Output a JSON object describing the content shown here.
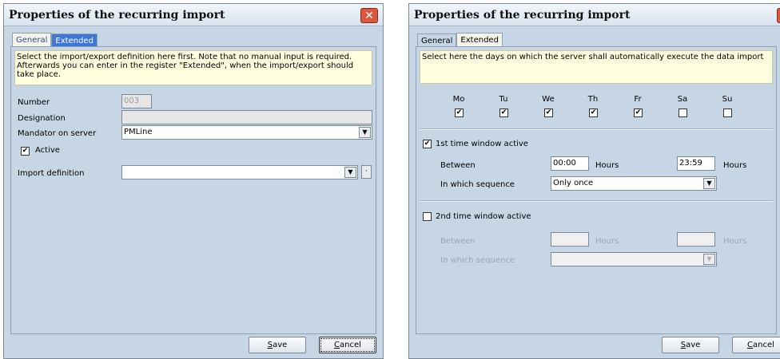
{
  "left_dialog": {
    "title": "Properties of the recurring import",
    "close_glyph": "✕",
    "tabs": [
      "General",
      "Extended"
    ],
    "info": "Select the import/export definition here first. Note that no manual input is required. Afterwards you can enter in the register \"Extended\", when the import/export should take place.",
    "number_label": "Number",
    "number_value": "003",
    "designation_label": "Designation",
    "designation_value": "",
    "mandator_label": "Mandator on server",
    "mandator_value": "PMLine",
    "active_label": "Active",
    "active_checked": true,
    "import_def_label": "Import definition",
    "import_def_value": "",
    "save_label": "Save",
    "cancel_label": "Cancel"
  },
  "right_dialog": {
    "title": "Properties of the recurring import",
    "close_glyph": "✕",
    "tabs": [
      "General",
      "Extended"
    ],
    "info": "Select here the days on which the server shall automatically execute the data import",
    "days": [
      {
        "label": "Mo",
        "checked": true
      },
      {
        "label": "Tu",
        "checked": true
      },
      {
        "label": "We",
        "checked": true
      },
      {
        "label": "Th",
        "checked": true
      },
      {
        "label": "Fr",
        "checked": true
      },
      {
        "label": "Sa",
        "checked": false
      },
      {
        "label": "Su",
        "checked": false
      }
    ],
    "window1": {
      "label": "1st time window active",
      "checked": true,
      "between_label": "Between",
      "from": "00:00",
      "hours1": "Hours",
      "to": "23:59",
      "hours2": "Hours",
      "sequence_label": "In which sequence",
      "sequence_value": "Only once"
    },
    "window2": {
      "label": "2nd time window active",
      "checked": false,
      "between_label": "Between",
      "from": "",
      "hours1": "Hours",
      "to": "",
      "hours2": "Hours",
      "sequence_label": "In which sequence",
      "sequence_value": ""
    },
    "save_label": "Save",
    "cancel_label": "Cancel"
  }
}
